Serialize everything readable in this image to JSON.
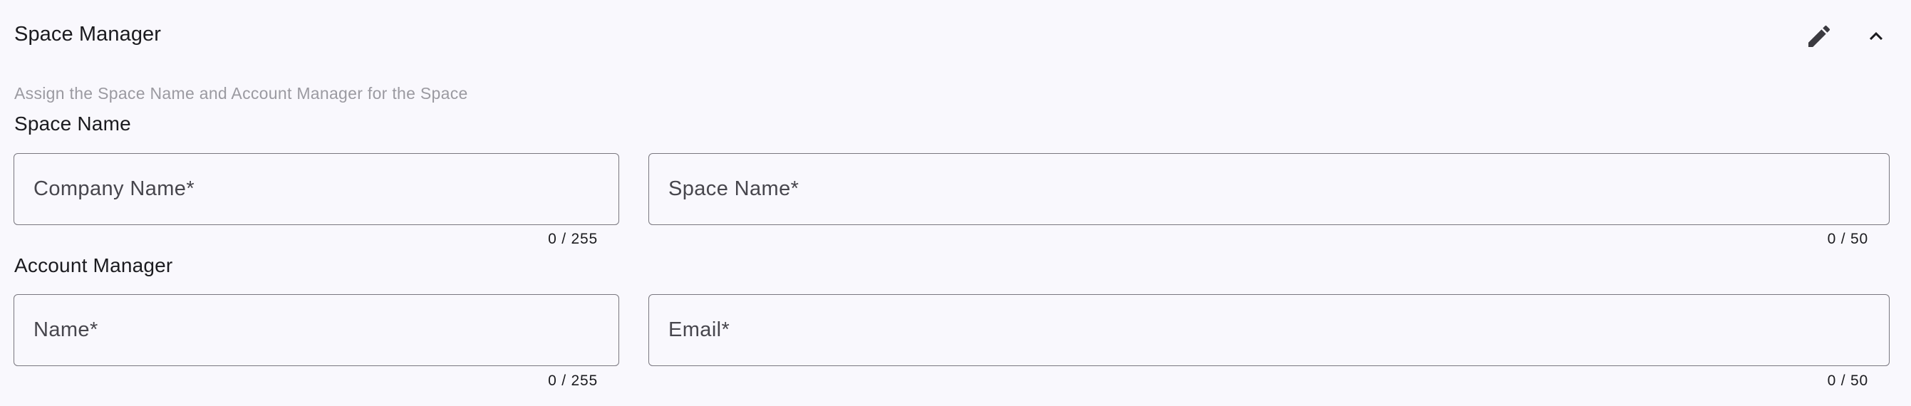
{
  "header": {
    "title": "Space Manager",
    "edit_icon": "pencil-icon",
    "collapse_icon": "chevron-up-icon"
  },
  "subtitle": "Assign the Space Name and Account Manager for the Space",
  "space_name_section": {
    "label": "Space Name",
    "company_name": {
      "placeholder": "Company Name*",
      "value": "",
      "counter": "0 / 255"
    },
    "space_name": {
      "placeholder": "Space Name*",
      "value": "",
      "counter": "0 / 50"
    }
  },
  "account_manager_section": {
    "label": "Account Manager",
    "name": {
      "placeholder": "Name*",
      "value": "",
      "counter": "0 / 255"
    },
    "email": {
      "placeholder": "Email*",
      "value": "",
      "counter": "0 / 50"
    }
  }
}
